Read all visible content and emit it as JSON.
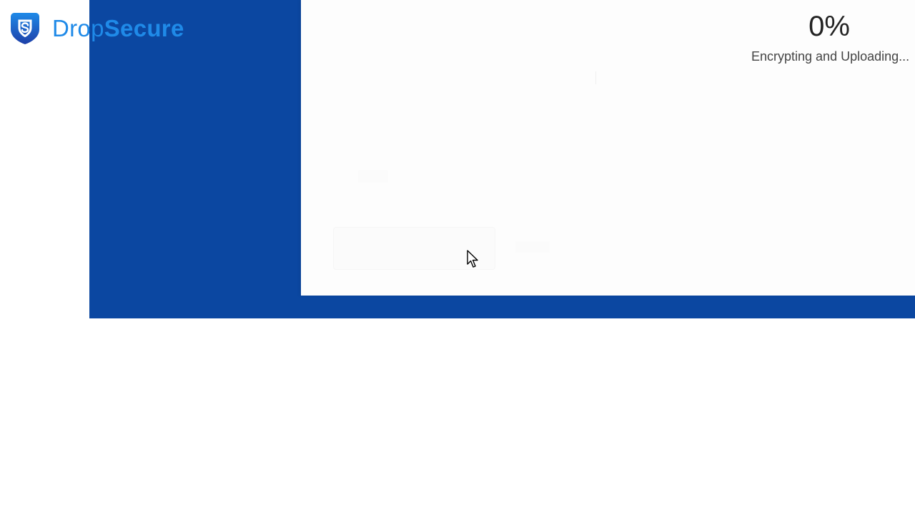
{
  "brand": {
    "name_light": "Drop",
    "name_bold": "Secure",
    "logo_icon": "shield-icon",
    "colors": {
      "logo_text": "#1f8ae8",
      "shield_top": "#1f8ae8",
      "shield_bottom": "#1d3fa8"
    }
  },
  "background": {
    "panel_color": "#0b47a1",
    "page_color": "#ffffff"
  },
  "upload": {
    "percent": "0%",
    "status": "Encrypting and Uploading..."
  },
  "cursor": {
    "icon": "mouse-pointer-icon"
  }
}
